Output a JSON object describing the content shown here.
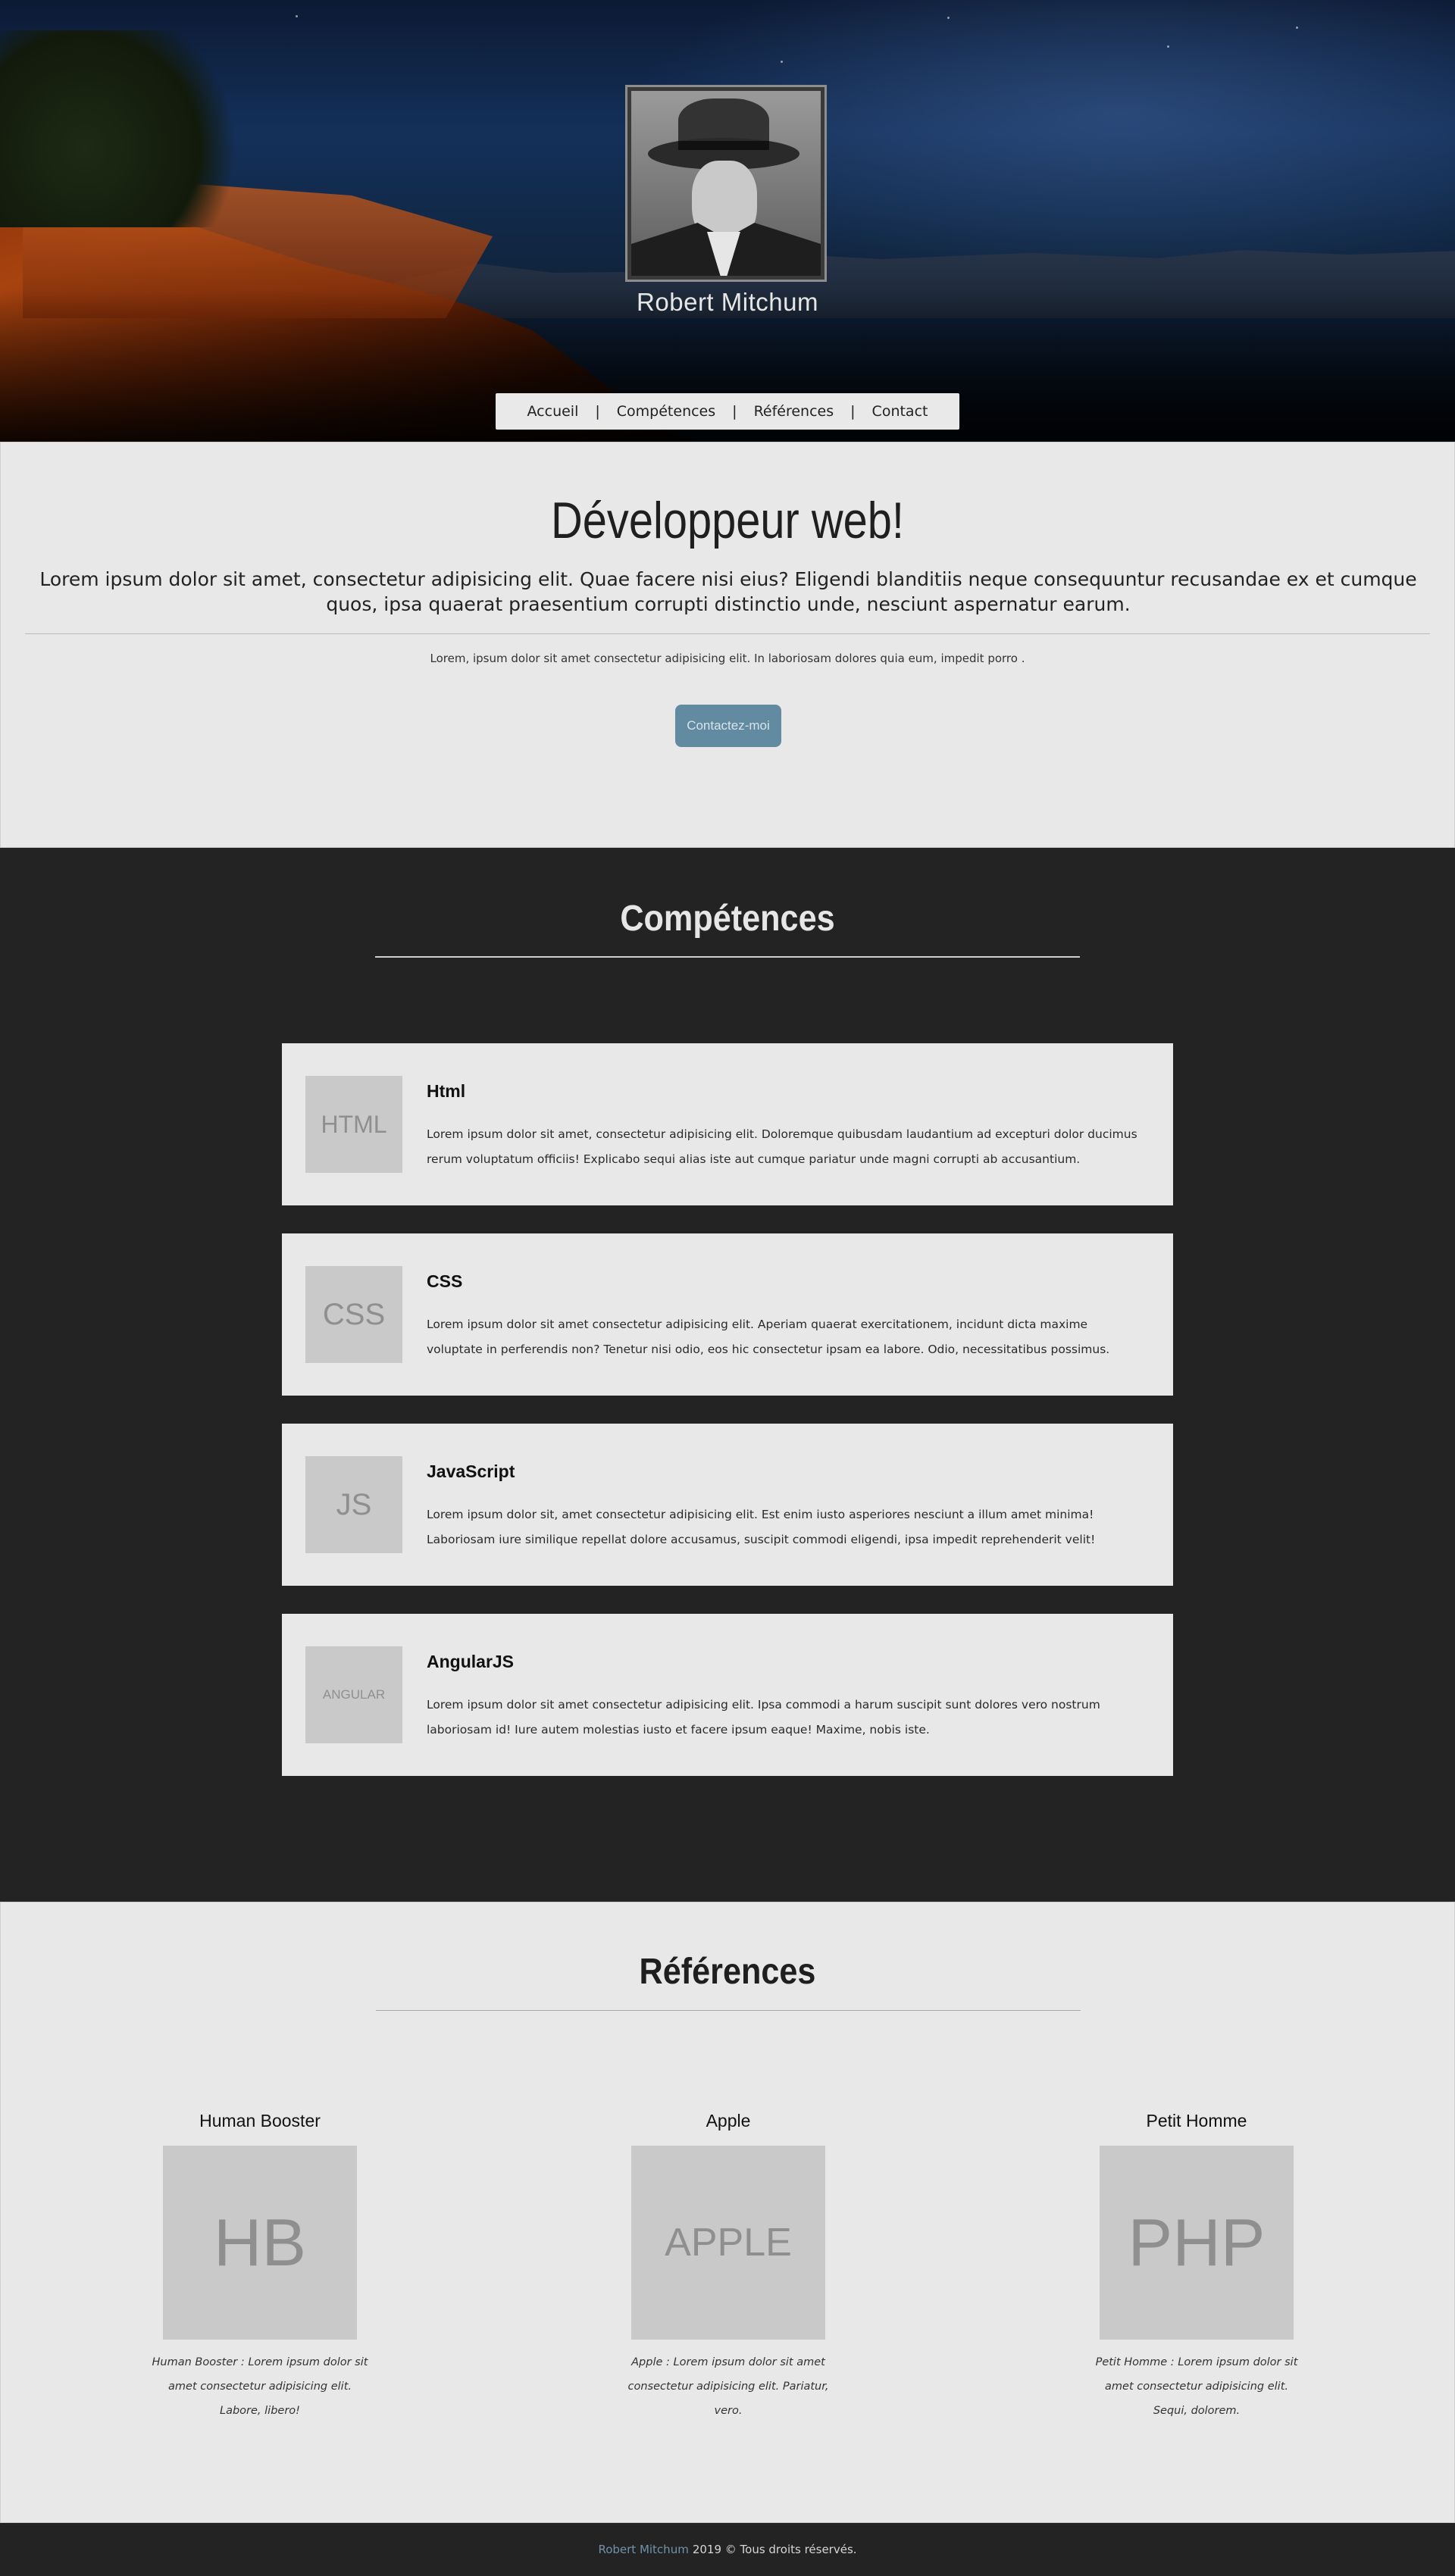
{
  "hero": {
    "name": "Robert Mitchum"
  },
  "nav": {
    "items": [
      {
        "label": "Accueil"
      },
      {
        "label": "Compétences"
      },
      {
        "label": "Références"
      },
      {
        "label": "Contact"
      }
    ],
    "separator": "|"
  },
  "intro": {
    "title": "Développeur web!",
    "lead": "Lorem ipsum dolor sit amet, consectetur adipisicing elit. Quae facere nisi eius? Eligendi blanditiis neque consequuntur recusandae ex et cumque quos, ipsa quaerat praesentium corrupti distinctio unde, nesciunt aspernatur earum.",
    "small": "Lorem, ipsum dolor sit amet consectetur adipisicing elit. In laboriosam dolores quia eum, impedit porro .",
    "button_label": "Contactez-moi"
  },
  "skills": {
    "title": "Compétences",
    "items": [
      {
        "thumb": "HTML",
        "name": "Html",
        "desc": "Lorem ipsum dolor sit amet, consectetur adipisicing elit. Doloremque quibusdam laudantium ad excepturi dolor ducimus rerum voluptatum officiis! Explicabo sequi alias iste aut cumque pariatur unde magni corrupti ab accusantium."
      },
      {
        "thumb": "CSS",
        "name": "CSS",
        "desc": "Lorem ipsum dolor sit amet consectetur adipisicing elit. Aperiam quaerat exercitationem, incidunt dicta maxime voluptate in perferendis non? Tenetur nisi odio, eos hic consectetur ipsam ea labore. Odio, necessitatibus possimus."
      },
      {
        "thumb": "JS",
        "name": "JavaScript",
        "desc": "Lorem ipsum dolor sit, amet consectetur adipisicing elit. Est enim iusto asperiores nesciunt a illum amet minima! Laboriosam iure similique repellat dolore accusamus, suscipit commodi eligendi, ipsa impedit reprehenderit velit!"
      },
      {
        "thumb": "ANGULAR",
        "name": "AngularJS",
        "desc": "Lorem ipsum dolor sit amet consectetur adipisicing elit. Ipsa commodi a harum suscipit sunt dolores vero nostrum laboriosam id! Iure autem molestias iusto et facere ipsum eaque! Maxime, nobis iste."
      }
    ]
  },
  "references": {
    "title": "Références",
    "items": [
      {
        "name": "Human Booster",
        "thumb": "HB",
        "desc": "Human Booster : Lorem ipsum dolor sit amet consectetur adipisicing elit. Labore, libero!"
      },
      {
        "name": "Apple",
        "thumb": "APPLE",
        "desc": "Apple : Lorem ipsum dolor sit amet consectetur adipisicing elit. Pariatur, vero."
      },
      {
        "name": "Petit Homme",
        "thumb": "PHP",
        "desc": "Petit Homme : Lorem ipsum dolor sit amet consectetur adipisicing elit. Sequi, dolorem."
      }
    ]
  },
  "footer": {
    "name": "Robert Mitchum",
    "text": "2019 © Tous droits réservés."
  },
  "colors": {
    "accent_button": "#628aa0",
    "dark_section": "#232323",
    "light_section": "#e8e8e8",
    "footer_name": "#6f93aa"
  }
}
